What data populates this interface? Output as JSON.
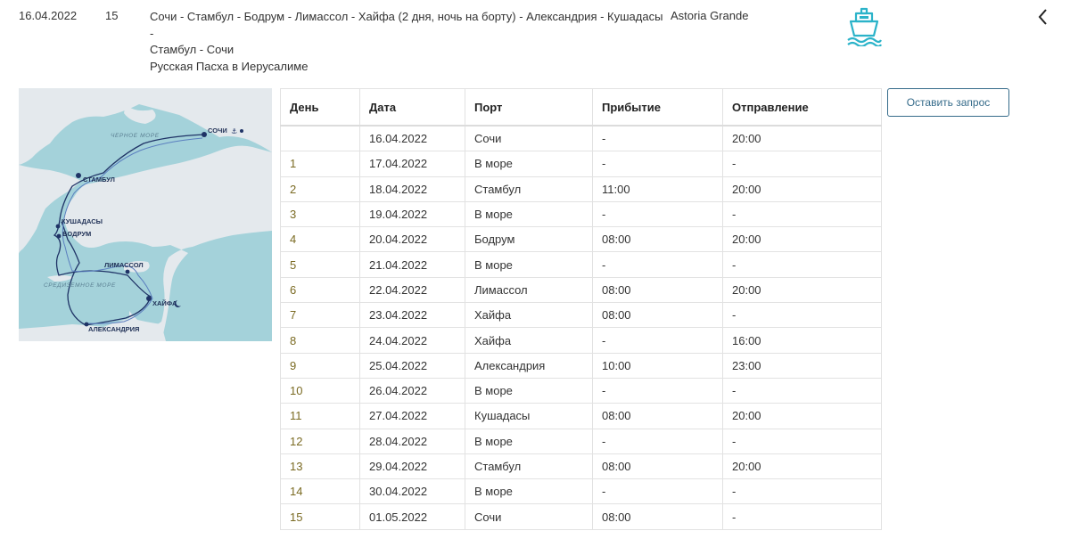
{
  "cruise": {
    "date": "16.04.2022",
    "days": "15",
    "route_line1": "Сочи - Стамбул - Бодрум - Лимассол - Хайфа (2 дня, ночь на борту) - Александрия - Кушадасы -",
    "route_line2": "Стамбул - Сочи",
    "route_name": "Русская Пасха в Иерусалиме",
    "ship": "Astoria Grande"
  },
  "map": {
    "labels": {
      "sochi": "СОЧИ",
      "istanbul": "СТАМБУЛ",
      "kusadasi": "КУШАДАСЫ",
      "bodrum": "БОДРУМ",
      "limassol": "ЛИМАССОЛ",
      "haifa": "ХАЙФА",
      "alexandria": "АЛЕКСАНДРИЯ",
      "black_sea": "ЧЕРНОЕ МОРЕ",
      "med_sea": "СРЕДИЗЕМНОЕ МОРЕ"
    },
    "colors": {
      "sea": "#a4d2da",
      "land": "#e4e9ed",
      "route": "#5b7fbf",
      "route_outer": "#1f3366"
    }
  },
  "table": {
    "headers": {
      "day": "День",
      "date": "Дата",
      "port": "Порт",
      "arrival": "Прибытие",
      "departure": "Отправление"
    },
    "rows": [
      {
        "day": "",
        "date": "16.04.2022",
        "port": "Сочи",
        "arr": "-",
        "dep": "20:00"
      },
      {
        "day": "1",
        "date": "17.04.2022",
        "port": "В море",
        "arr": "-",
        "dep": "-"
      },
      {
        "day": "2",
        "date": "18.04.2022",
        "port": "Стамбул",
        "arr": "11:00",
        "dep": "20:00"
      },
      {
        "day": "3",
        "date": "19.04.2022",
        "port": "В море",
        "arr": "-",
        "dep": "-"
      },
      {
        "day": "4",
        "date": "20.04.2022",
        "port": "Бодрум",
        "arr": "08:00",
        "dep": "20:00"
      },
      {
        "day": "5",
        "date": "21.04.2022",
        "port": "В море",
        "arr": "-",
        "dep": "-"
      },
      {
        "day": "6",
        "date": "22.04.2022",
        "port": "Лимассол",
        "arr": "08:00",
        "dep": "20:00"
      },
      {
        "day": "7",
        "date": "23.04.2022",
        "port": "Хайфа",
        "arr": "08:00",
        "dep": "-"
      },
      {
        "day": "8",
        "date": "24.04.2022",
        "port": "Хайфа",
        "arr": "-",
        "dep": "16:00"
      },
      {
        "day": "9",
        "date": "25.04.2022",
        "port": "Александрия",
        "arr": "10:00",
        "dep": "23:00"
      },
      {
        "day": "10",
        "date": "26.04.2022",
        "port": "В море",
        "arr": "-",
        "dep": "-"
      },
      {
        "day": "11",
        "date": "27.04.2022",
        "port": "Кушадасы",
        "arr": "08:00",
        "dep": "20:00"
      },
      {
        "day": "12",
        "date": "28.04.2022",
        "port": "В море",
        "arr": "-",
        "dep": "-"
      },
      {
        "day": "13",
        "date": "29.04.2022",
        "port": "Стамбул",
        "arr": "08:00",
        "dep": "20:00"
      },
      {
        "day": "14",
        "date": "30.04.2022",
        "port": "В море",
        "arr": "-",
        "dep": "-"
      },
      {
        "day": "15",
        "date": "01.05.2022",
        "port": "Сочи",
        "arr": "08:00",
        "dep": "-"
      }
    ]
  },
  "request_button": "Оставить запрос",
  "icons": {
    "ship": "ship-icon",
    "back": "chevron-left-icon",
    "ship_color": "#2bb3c9"
  }
}
